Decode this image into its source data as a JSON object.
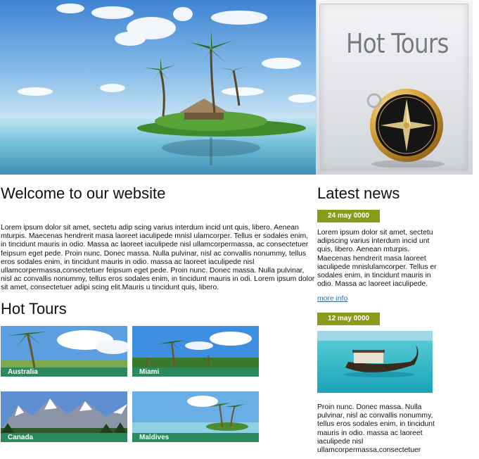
{
  "header": {
    "logo_text": "Hot Tours",
    "hero_alt": "tropical island with palm trees"
  },
  "welcome": {
    "title": "Welcome to our website",
    "body": "Lorem ipsum dolor sit amet, sectetu adip scing varius interdum incid unt quis, libero. Aenean mturpis. Maecenas hendrerit masa laoreet iaculipede mnisl ulamcorper. Tellus er sodales enim, in tincidunt mauris in odio. Massa ac laoreet iaculipede nisl ullamcorpermassa, ac consectetuer feipsum eget pede. Proin nunc. Donec massa. Nulla pulvinar, nisl ac convallis nonummy, tellus eros sodales enim, in tincidunt mauris in odio. massa ac laoreet iaculipede nisl ullamcorpermassa,consectetuer feipsum eget pede. Proin nunc. Donec massa. Nulla pulvinar, nisl ac convallis nonummy, tellus eros sodales enim, in tincidunt mauris in odi. Lorem ipsum dolor sit amet, consectetuer adipi scing elit.Mauris u tincidunt quis, libero."
  },
  "hot_tours": {
    "title": "Hot Tours",
    "items": [
      {
        "label": "Australia"
      },
      {
        "label": "Miami"
      },
      {
        "label": "Canada"
      },
      {
        "label": "Maldives"
      }
    ]
  },
  "news": {
    "title": "Latest news",
    "items": [
      {
        "date": "24 may 0000",
        "text": "Lorem ipsum dolor sit amet, sectetu adipscing varius interdum incid unt quis, libero. Aenean mturpis. Maecenas hendrerit masa laoreet iaculipede mnislulamcorper. Tellus er sodales enim, in tincidunt mauris in odio. Massa ac laoreet iaculipede.",
        "link": "more info"
      },
      {
        "date": "12 may 0000",
        "text": "Proin nunc. Donec massa. Nulla pulvinar, nisl ac convallis nonummy, tellus eros sodales enim, in tincidunt mauris in odio. massa ac laoreet iaculipede nisl ullamcorpermassa,consectetuer"
      }
    ]
  },
  "colors": {
    "tour_label_bg": "#2a8a5e",
    "date_badge_bg": "#8a9a1a",
    "link": "#2b6fa7"
  }
}
